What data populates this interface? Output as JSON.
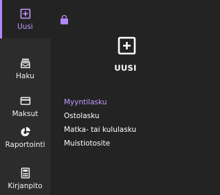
{
  "colors": {
    "accent": "#b388ff",
    "sidebar_bg": "#2c2c2c",
    "main_bg": "#232323",
    "text": "#ffffff"
  },
  "sidebar": {
    "items": [
      {
        "label": "Uusi",
        "icon": "plus-square-icon",
        "active": true
      },
      {
        "label": "Haku",
        "icon": "inbox-stack-icon",
        "active": false
      },
      {
        "label": "Maksut",
        "icon": "card-icon",
        "active": false
      },
      {
        "label": "Raportointi",
        "icon": "pie-chart-icon",
        "active": false
      },
      {
        "label": "Kirjanpito",
        "icon": "calculator-icon",
        "active": false
      }
    ]
  },
  "main": {
    "top_icon": "shopping-bag-icon",
    "hero_icon": "plus-square-icon",
    "title": "UUSI",
    "menu": [
      {
        "label": "Myyntilasku",
        "selected": true
      },
      {
        "label": "Ostolasku",
        "selected": false
      },
      {
        "label": "Matka- tai kululasku",
        "selected": false
      },
      {
        "label": "Muistiotosite",
        "selected": false
      }
    ]
  }
}
